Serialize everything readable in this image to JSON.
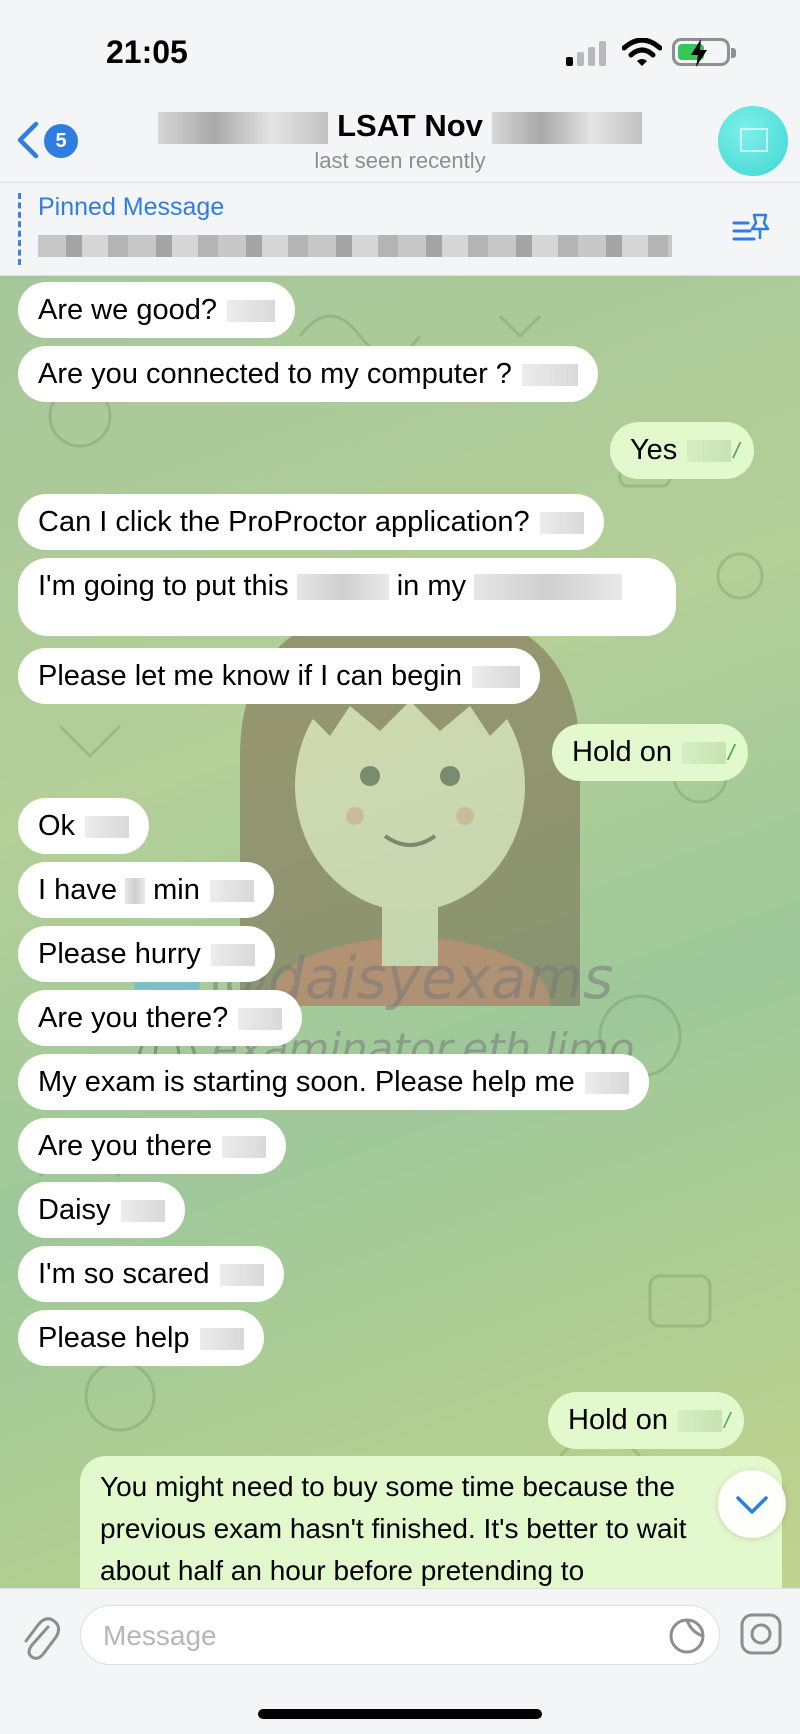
{
  "status_bar": {
    "time": "21:05"
  },
  "header": {
    "back_badge": "5",
    "title": "LSAT Nov",
    "subtitle": "last seen recently"
  },
  "pinned": {
    "label": "Pinned Message"
  },
  "messages": [
    {
      "dir": "in",
      "text": "Are we good?"
    },
    {
      "dir": "in",
      "text": "Are you connected to my computer ?"
    },
    {
      "dir": "out",
      "text": "Yes"
    },
    {
      "dir": "in",
      "text": "Can I click the ProProctor application?"
    },
    {
      "dir": "in",
      "text_a": "I'm going to put this",
      "text_b": "in my"
    },
    {
      "dir": "in",
      "text": "Please let me know if I can begin"
    },
    {
      "dir": "out",
      "text": "Hold on"
    },
    {
      "dir": "in",
      "text": "Ok"
    },
    {
      "dir": "in",
      "text_a": "I have",
      "text_b": "min"
    },
    {
      "dir": "in",
      "text": "Please hurry"
    },
    {
      "dir": "in",
      "text": "Are you there?"
    },
    {
      "dir": "in",
      "text": "My exam is starting soon. Please help me"
    },
    {
      "dir": "in",
      "text": "Are you there"
    },
    {
      "dir": "in",
      "text": "Daisy"
    },
    {
      "dir": "in",
      "text": "I'm so scared"
    },
    {
      "dir": "in",
      "text": "Please help"
    },
    {
      "dir": "out",
      "text": "Hold on"
    },
    {
      "dir": "out",
      "text": "You might need to buy some time because the previous exam hasn't finished. It's better to wait about half an hour before pretending to"
    }
  ],
  "watermark": {
    "handle": "@daisyexams",
    "site": "examinator.eth.limo"
  },
  "input": {
    "placeholder": "Message"
  },
  "icons": {
    "back": "chevron-left-icon",
    "pin": "pin-list-icon",
    "attach": "paperclip-icon",
    "sticker": "sticker-icon",
    "camera": "camera-icon",
    "scroll": "chevron-down-icon"
  },
  "colors": {
    "accent": "#2f7de1",
    "outgoing": "#e2f8cd",
    "incoming": "#ffffff",
    "read_ticks": "#4fae4e"
  }
}
